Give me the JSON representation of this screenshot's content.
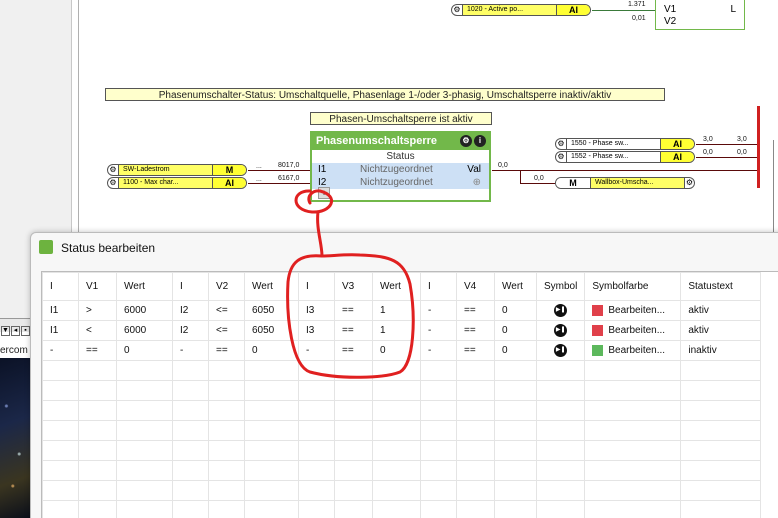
{
  "canvas": {
    "top_pill": {
      "text": "1020 - Active po...",
      "type": "AI",
      "value": "1.371",
      "value2": "0,01"
    },
    "v_block": {
      "in1": "V1",
      "in2": "V2",
      "out": "L"
    },
    "banner_status": "Phasenumschalter-Status: Umschaltquelle, Phasenlage 1-/oder 3-phasig, Umschaltsperre inaktiv/aktiv",
    "banner_block": "Phasen-Umschaltsperre ist aktiv",
    "block": {
      "title": "Phasenumschaltsperre",
      "status": "Status",
      "i1": "I1",
      "i2": "I2",
      "unassigned": "Nichtzugeordnet",
      "out": "Val",
      "plus": "+"
    },
    "left_pills": [
      {
        "text": "SW-Ladestrom",
        "type": "M",
        "value": "8017,0"
      },
      {
        "text": "1100 - Max char...",
        "type": "AI",
        "value": "6167,0"
      }
    ],
    "right_pills": [
      {
        "text": "1550 - Phase sw...",
        "type": "AI",
        "value_a": "3,0",
        "value_b": "3,0"
      },
      {
        "text": "1552 - Phase sw...",
        "type": "AI",
        "value_a": "0,0",
        "value_b": "0,0"
      }
    ],
    "wallbox_pill": {
      "text": "Wallbox-Umscha...",
      "type": "M",
      "value_in": "0,0",
      "value_out": "0,0"
    },
    "ellipsis": "..."
  },
  "taskbar_text": "ercom",
  "dialog": {
    "title": "Status bearbeiten",
    "columns": [
      "I",
      "V1",
      "Wert",
      "I",
      "V2",
      "Wert",
      "I",
      "V3",
      "Wert",
      "I",
      "V4",
      "Wert",
      "Symbol",
      "Symbolfarbe",
      "Statustext"
    ],
    "rows": [
      {
        "cells": [
          "I1",
          ">",
          "6000",
          "I2",
          "<=",
          "6050",
          "I3",
          "==",
          "1",
          "-",
          "==",
          "0"
        ],
        "color_hex": "#e0404a",
        "color_label": "Bearbeiten...",
        "status": "aktiv"
      },
      {
        "cells": [
          "I1",
          "<",
          "6000",
          "I2",
          "<=",
          "6050",
          "I3",
          "==",
          "1",
          "-",
          "==",
          "0"
        ],
        "color_hex": "#e0404a",
        "color_label": "Bearbeiten...",
        "status": "aktiv"
      },
      {
        "cells": [
          "-",
          "==",
          "0",
          "-",
          "==",
          "0",
          "-",
          "==",
          "0",
          "-",
          "==",
          "0"
        ],
        "color_hex": "#5cb85c",
        "color_label": "Bearbeiten...",
        "status": "inaktiv"
      }
    ],
    "symbol_icon": "play-pause-icon"
  }
}
